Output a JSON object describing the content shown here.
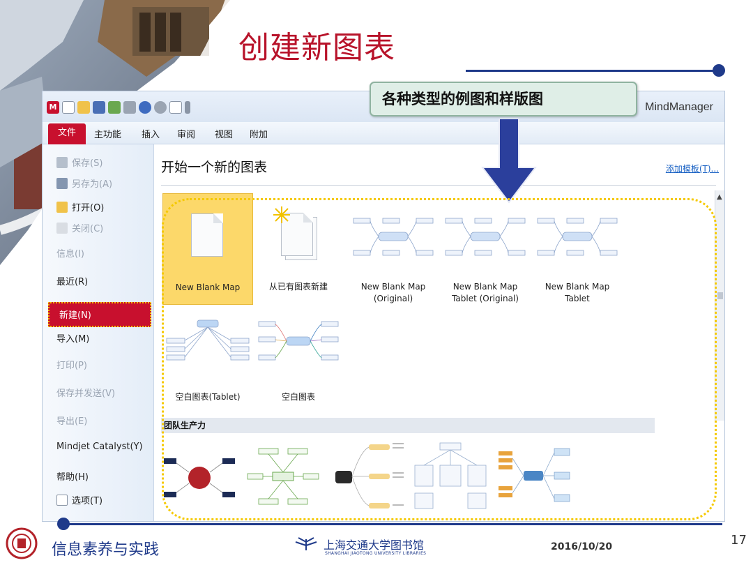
{
  "slide": {
    "title": "创建新图表",
    "callout": "各种类型的例图和样版图",
    "footer": {
      "course": "信息素养与实践",
      "library": "上海交通大学图书馆",
      "library_en": "SHANGHAI JIAOTONG UNIVERSITY LIBRARIES",
      "date": "2016/10/20",
      "page": "17"
    }
  },
  "app": {
    "name": "MindManager",
    "menus": [
      "主功能",
      "插入",
      "审阅",
      "视图",
      "附加"
    ],
    "file_tab": "文件",
    "sidebar": {
      "save": "保存(S)",
      "save_as": "另存为(A)",
      "open": "打开(O)",
      "close": "关闭(C)",
      "info": "信息(I)",
      "recent": "最近(R)",
      "new": "新建(N)",
      "import": "导入(M)",
      "print": "打印(P)",
      "save_send": "保存并发送(V)",
      "export": "导出(E)",
      "catalyst": "Mindjet Catalyst(Y)",
      "help": "帮助(H)",
      "options": "选项(T)"
    },
    "main": {
      "title": "开始一个新的图表",
      "add_template": "添加模板(T)...",
      "tiles": [
        {
          "line1": "New Blank Map",
          "line2": ""
        },
        {
          "line1": "从已有图表新建",
          "line2": ""
        },
        {
          "line1": "New Blank Map",
          "line2": "(Original)"
        },
        {
          "line1": "New Blank Map",
          "line2": "Tablet (Original)"
        },
        {
          "line1": "New Blank Map",
          "line2": "Tablet"
        },
        {
          "line1": "空白图表(Tablet)",
          "line2": ""
        },
        {
          "line1": "空白图表",
          "line2": ""
        }
      ],
      "section": "团队生产力"
    }
  },
  "colors": {
    "brand_red": "#c8102e",
    "title_red": "#b8132a",
    "navy": "#1f3a8a",
    "highlight_yellow": "#f5c900",
    "selected_tile": "#fcd86a"
  }
}
